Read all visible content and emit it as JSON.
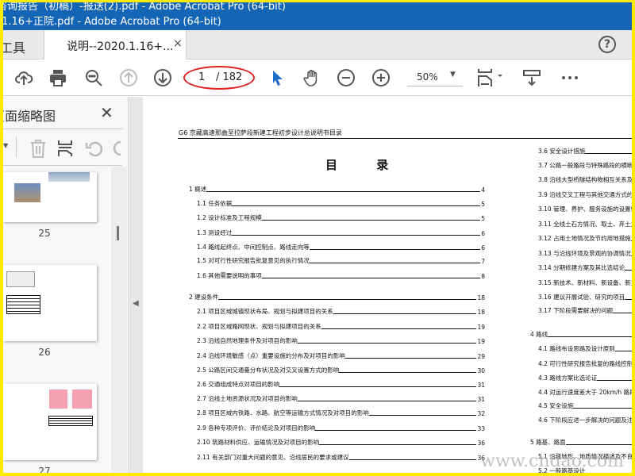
{
  "window": {
    "title_back": "咨询报告（初稿）-报送(2).pdf - Adobe Acrobat Pro (64-bit)",
    "title_front": ".1.16+正院.pdf - Adobe Acrobat Pro (64-bit)",
    "watermark": "蓝荷网"
  },
  "tabs": {
    "tools": "工具",
    "document": "说明--2020.1.16+...",
    "close": "×",
    "help": "?"
  },
  "toolbar": {
    "page_current": "1",
    "page_total": "/ 182",
    "zoom": "50%",
    "highlight_color": "#e02020"
  },
  "sidebar": {
    "title": "页面缩略图",
    "close": "✕",
    "thumbnails": [
      {
        "label": "25"
      },
      {
        "label": "26"
      },
      {
        "label": "27"
      }
    ]
  },
  "document": {
    "header": "G6 京藏高速那曲至拉萨段新建工程初步设计总说明书目录",
    "toc_title": "目 录",
    "left_toc": [
      {
        "text": "1 概述",
        "page": "4",
        "level": 1
      },
      {
        "text": "1.1  任务依据",
        "page": "5",
        "level": 2
      },
      {
        "text": "1.2  设计标准及工程规模",
        "page": "5",
        "level": 2
      },
      {
        "text": "1.3  测设经过",
        "page": "6",
        "level": 2
      },
      {
        "text": "1.4  路线起终点、中间控制点、路线走向等",
        "page": "6",
        "level": 2
      },
      {
        "text": "1.5  对可行性研究报告批复意见的执行情况",
        "page": "7",
        "level": 2
      },
      {
        "text": "1.6  其他需要说明的事项",
        "page": "8",
        "level": 2
      },
      {
        "text": "2 建设条件",
        "page": "18",
        "level": 1
      },
      {
        "text": "2.1  项目区域城镇现状布局、规划与拟建项目的关系",
        "page": "18",
        "level": 2
      },
      {
        "text": "2.2  项目区域路网现状、规划与拟建项目的关系",
        "page": "19",
        "level": 2
      },
      {
        "text": "2.3  沿线自然地理条件及对项目的影响",
        "page": "19",
        "level": 2
      },
      {
        "text": "2.4  沿线环境敏感（点）重要设施的分布及对项目的影响",
        "page": "29",
        "level": 2
      },
      {
        "text": "2.5  公路区间交通量分布状况及对交叉设置方式的影响",
        "page": "30",
        "level": 2
      },
      {
        "text": "2.6  交通组成特点对项目的影响",
        "page": "31",
        "level": 2
      },
      {
        "text": "2.7  沿线土地资源状况及对项目的影响",
        "page": "31",
        "level": 2
      },
      {
        "text": "2.8  项目区域内铁路、水路、航空等运输方式情况及对项目的影响",
        "page": "32",
        "level": 2
      },
      {
        "text": "2.9  各种专项评价、评价结论及对项目的影响",
        "page": "33",
        "level": 2
      },
      {
        "text": "2.10  筑路材料供应、运输情况及对项目的影响",
        "page": "36",
        "level": 2
      },
      {
        "text": "2.11  有关部门对重大问题的意见、沿线居民的要求或建议",
        "page": "36",
        "level": 2
      }
    ],
    "right_toc": [
      {
        "text": "3.6  安全设计措施",
        "level": 2
      },
      {
        "text": "3.7  公路一般路段与特殊路段的横断",
        "level": 2
      },
      {
        "text": "3.8  沿线大型桥隧结构物相互关系及",
        "level": 2
      },
      {
        "text": "3.9  沿线交叉工程与其他交通方式的",
        "level": 2
      },
      {
        "text": "3.10  管理、养护、服务设施的设置情",
        "level": 2
      },
      {
        "text": "3.11  全线土石方情况、取土、弃土之",
        "level": 2
      },
      {
        "text": "3.12  占用土地情况及节约用地措施",
        "level": 2
      },
      {
        "text": "3.13  与沿线环境及景观的协调情况",
        "level": 2
      },
      {
        "text": "3.14  分期修建方案及其比选结论",
        "level": 2
      },
      {
        "text": "3.15  新技术、新材料、新设备、新工",
        "level": 2
      },
      {
        "text": "3.16  建议开展试验、研究的项目",
        "level": 2
      },
      {
        "text": "3.17  下阶段需要解决的问题",
        "level": 2
      },
      {
        "text": "4 路线",
        "level": 1
      },
      {
        "text": "4.1  路线布设思路及设计原则",
        "level": 2
      },
      {
        "text": "4.2  可行性研究报告批复的路线控制",
        "level": 2
      },
      {
        "text": "4.3  路线方案比选论证",
        "level": 2
      },
      {
        "text": "4.4  对运行速度差大于 20km/h 路段",
        "level": 2
      },
      {
        "text": "4.5 安全设施",
        "level": 2
      },
      {
        "text": "4.6  下阶段应进一步解决的问题及注",
        "level": 2
      },
      {
        "text": "5 路基、路面",
        "level": 1
      },
      {
        "text": "5.1  沿线地形、地质情况描述及不良",
        "level": 2
      },
      {
        "text": "5.2  一般路基设计",
        "level": 2
      }
    ],
    "watermark": "www.cndao.com"
  }
}
